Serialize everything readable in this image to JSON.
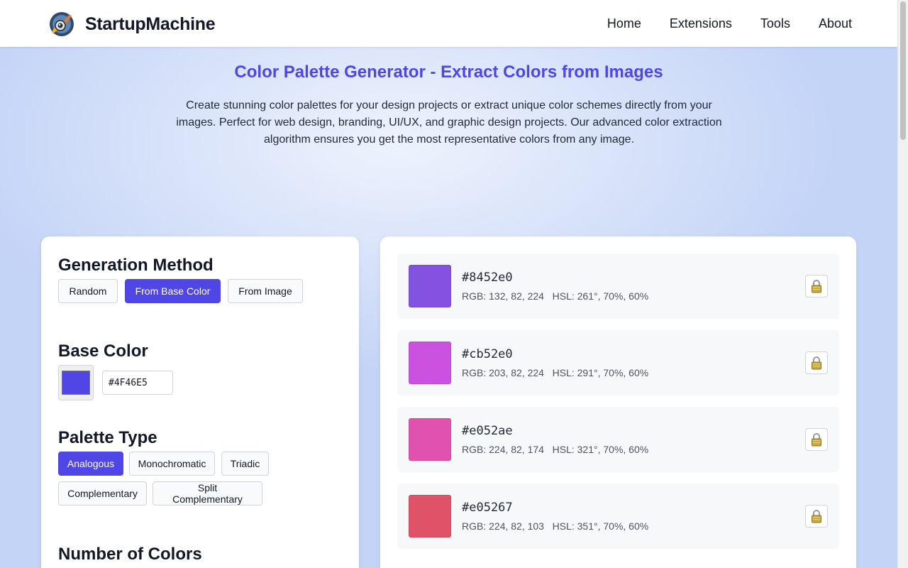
{
  "header": {
    "brand": "StartupMachine",
    "nav": [
      "Home",
      "Extensions",
      "Tools",
      "About"
    ]
  },
  "hero": {
    "title": "Color Palette Generator - Extract Colors from Images",
    "description": "Create stunning color palettes for your design projects or extract unique color schemes directly from your images. Perfect for web design, branding, UI/UX, and graphic design projects. Our advanced color extraction algorithm ensures you get the most representative colors from any image."
  },
  "controls": {
    "generation_method": {
      "title": "Generation Method",
      "options": [
        "Random",
        "From Base Color",
        "From Image"
      ],
      "selected": "From Base Color"
    },
    "base_color": {
      "title": "Base Color",
      "value": "#4F46E5"
    },
    "palette_type": {
      "title": "Palette Type",
      "options": [
        "Analogous",
        "Monochromatic",
        "Triadic",
        "Complementary",
        "Split Complementary"
      ],
      "selected": "Analogous"
    },
    "number_of_colors": {
      "title": "Number of Colors"
    }
  },
  "palette": [
    {
      "hex": "#8452e0",
      "info": "RGB: 132, 82, 224   HSL: 261°, 70%, 60%"
    },
    {
      "hex": "#cb52e0",
      "info": "RGB: 203, 82, 224   HSL: 291°, 70%, 60%"
    },
    {
      "hex": "#e052ae",
      "info": "RGB: 224, 82, 174   HSL: 321°, 70%, 60%"
    },
    {
      "hex": "#e05267",
      "info": "RGB: 224, 82, 103   HSL: 351°, 70%, 60%"
    }
  ],
  "icons": {
    "logo": "rocket-logo-icon",
    "lock": "lock-icon"
  },
  "colors": {
    "accent": "#4f46e5"
  }
}
